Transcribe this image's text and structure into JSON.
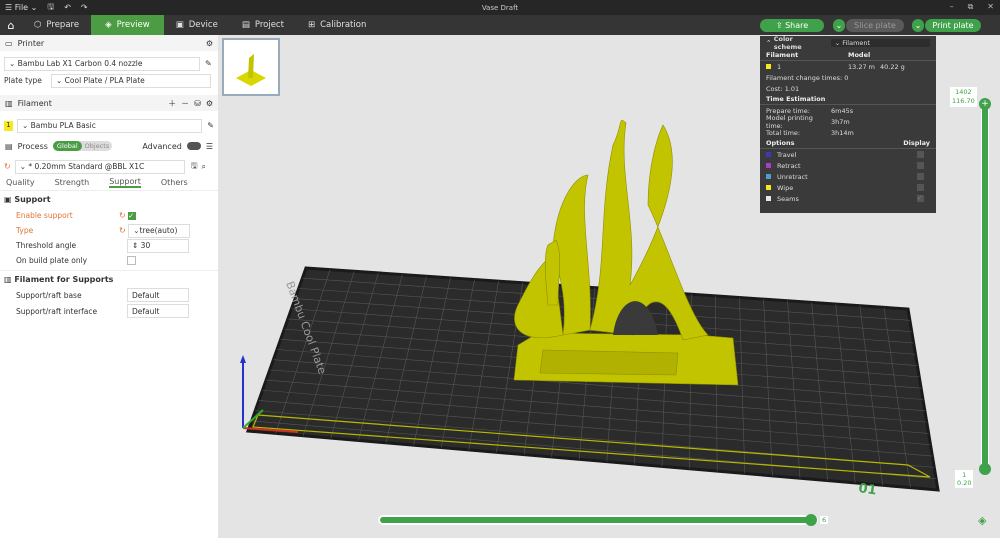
{
  "window": {
    "title": "Vase Draft",
    "file_menu": "File"
  },
  "tabs": [
    {
      "label": "Prepare",
      "icon": "cube-icon"
    },
    {
      "label": "Preview",
      "icon": "layers-icon",
      "active": true
    },
    {
      "label": "Device",
      "icon": "device-icon"
    },
    {
      "label": "Project",
      "icon": "project-icon"
    },
    {
      "label": "Calibration",
      "icon": "calibration-icon"
    }
  ],
  "actions": {
    "share": "Share",
    "slice": "Slice plate",
    "print": "Print plate"
  },
  "printer": {
    "section": "Printer",
    "name": "Bambu Lab X1 Carbon 0.4 nozzle",
    "plate_type_label": "Plate type",
    "plate_type": "Cool Plate / PLA Plate"
  },
  "filament": {
    "section": "Filament",
    "slot": "1",
    "name": "Bambu PLA Basic",
    "color": "#f5ea1e"
  },
  "process": {
    "section": "Process",
    "global": "Global",
    "objects": "Objects",
    "advanced": "Advanced",
    "preset": "* 0.20mm Standard @BBL X1C",
    "subtabs": [
      "Quality",
      "Strength",
      "Support",
      "Others"
    ],
    "active_subtab": "Support"
  },
  "support": {
    "title": "Support",
    "enable_label": "Enable support",
    "enable": true,
    "type_label": "Type",
    "type": "tree(auto)",
    "threshold_label": "Threshold angle",
    "threshold": "30",
    "build_plate_label": "On build plate only",
    "build_plate": false
  },
  "filament_supports": {
    "title": "Filament for Supports",
    "base_label": "Support/raft base",
    "base": "Default",
    "interface_label": "Support/raft interface",
    "interface": "Default"
  },
  "legend": {
    "color_scheme_label": "Color scheme",
    "color_scheme": "Filament",
    "col_filament": "Filament",
    "col_model": "Model",
    "slot": "1",
    "length": "13.27 m",
    "weight": "40.22 g",
    "change_times": "Filament change times:  0",
    "cost": "Cost:  1.01",
    "time_title": "Time Estimation",
    "prepare_label": "Prepare time:",
    "prepare": "6m45s",
    "model_label": "Model printing time:",
    "model": "3h7m",
    "total_label": "Total time:",
    "total": "3h14m",
    "options_title": "Options",
    "display_title": "Display",
    "options": [
      {
        "label": "Travel",
        "color": "#3a3ab8",
        "on": false
      },
      {
        "label": "Retract",
        "color": "#b03ac8",
        "on": false
      },
      {
        "label": "Unretract",
        "color": "#4a9ed0",
        "on": false
      },
      {
        "label": "Wipe",
        "color": "#f5ea1e",
        "on": false
      },
      {
        "label": "Seams",
        "color": "#e8e8e8",
        "on": true
      }
    ]
  },
  "layer_slider": {
    "top_layer": "1402",
    "top_height": "116.70",
    "bottom_layer": "1",
    "bottom_height": "0.20"
  },
  "move_slider": {
    "value": "6",
    "fraction": 1.0
  },
  "plate": {
    "number": "01",
    "brand": "Bambu Cool Plate"
  },
  "colors": {
    "accent": "#4b9c43",
    "model": "#c3c400"
  }
}
